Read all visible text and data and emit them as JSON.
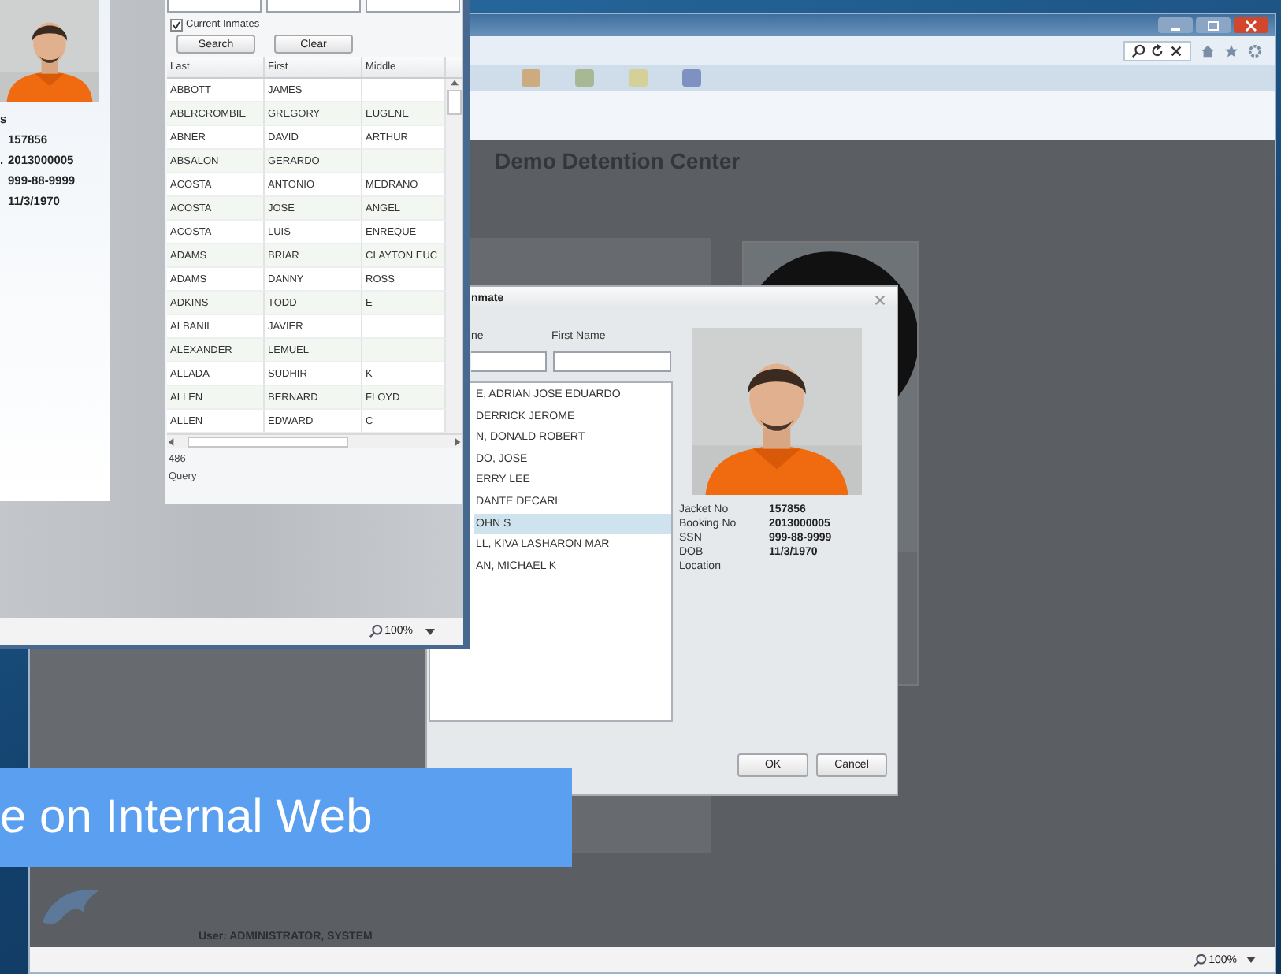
{
  "slide_caption": "e on Internal Web",
  "browser_window": {
    "page_title": "Demo Detention Center",
    "user_line": "User: ADMINISTRATOR, SYSTEM",
    "zoom": "100%"
  },
  "search_dialog": {
    "title": "nmate",
    "field_labels": [
      "ne",
      "First Name"
    ],
    "results": [
      {
        "text": "E, ADRIAN JOSE EDUARDO",
        "selected": false
      },
      {
        "text": "DERRICK JEROME",
        "selected": false
      },
      {
        "text": "N, DONALD ROBERT",
        "selected": false
      },
      {
        "text": "DO, JOSE",
        "selected": false
      },
      {
        "text": "ERRY LEE",
        "selected": false
      },
      {
        "text": "DANTE DECARL",
        "selected": false
      },
      {
        "text": "OHN S",
        "selected": true
      },
      {
        "text": "LL, KIVA LASHARON MAR",
        "selected": false
      },
      {
        "text": "AN, MICHAEL K",
        "selected": false
      }
    ],
    "details": [
      {
        "label": "Jacket No",
        "value": "157856"
      },
      {
        "label": "Booking No",
        "value": "2013000005"
      },
      {
        "label": "SSN",
        "value": "999-88-9999"
      },
      {
        "label": "DOB",
        "value": "11/3/1970"
      },
      {
        "label": "Location"
      }
    ],
    "buttons": [
      "OK",
      "Cancel"
    ]
  },
  "inmate_window": {
    "details": [
      {
        "label": "s"
      },
      {
        "value": "157856"
      },
      {
        "label": ".",
        "value": "2013000005"
      },
      {
        "value": "999-88-9999"
      },
      {
        "value": "11/3/1970"
      }
    ],
    "current_inmates": {
      "label": "Current Inmates",
      "checked": true
    },
    "buttons": [
      "Search",
      "Clear"
    ],
    "table": {
      "columns": [
        "Last",
        "First",
        "Middle"
      ],
      "rows": [
        {
          "last": "ABBOTT",
          "first": "JAMES"
        },
        {
          "last": "ABERCROMBIE",
          "first": "GREGORY",
          "middle": "EUGENE"
        },
        {
          "last": "ABNER",
          "first": "DAVID",
          "middle": "ARTHUR"
        },
        {
          "last": "ABSALON",
          "first": "GERARDO"
        },
        {
          "last": "ACOSTA",
          "first": "ANTONIO",
          "middle": "MEDRANO"
        },
        {
          "last": "ACOSTA",
          "first": "JOSE",
          "middle": "ANGEL"
        },
        {
          "last": "ACOSTA",
          "first": "LUIS",
          "middle": "ENREQUE"
        },
        {
          "last": "ADAMS",
          "first": "BRIAR",
          "middle": "CLAYTON EUC"
        },
        {
          "last": "ADAMS",
          "first": "DANNY",
          "middle": "ROSS"
        },
        {
          "last": "ADKINS",
          "first": "TODD",
          "middle": "E"
        },
        {
          "last": "ALBANIL",
          "first": "JAVIER"
        },
        {
          "last": "ALEXANDER",
          "first": "LEMUEL"
        },
        {
          "last": "ALLADA",
          "first": "SUDHIR",
          "middle": "K"
        },
        {
          "last": "ALLEN",
          "first": "BERNARD",
          "middle": "FLOYD"
        },
        {
          "last": "ALLEN",
          "first": "EDWARD",
          "middle": "C"
        }
      ]
    },
    "count": "486",
    "query_label": "Query",
    "zoom": "100%"
  }
}
